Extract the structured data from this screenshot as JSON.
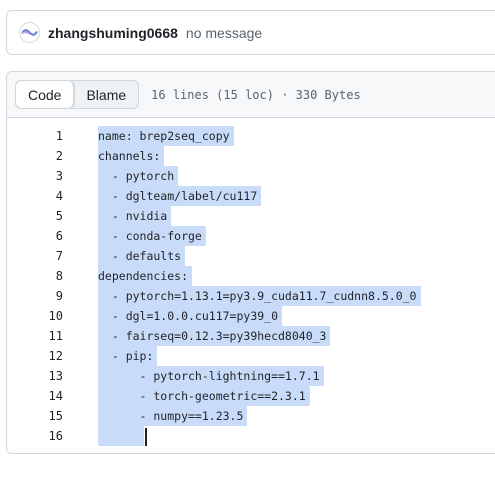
{
  "commit": {
    "author": "zhangshuming0668",
    "message": "no message",
    "avatar_icon": "avatar-wave-icon"
  },
  "file": {
    "tabs": [
      {
        "label": "Code",
        "active": true
      },
      {
        "label": "Blame",
        "active": false
      }
    ],
    "info": "16 lines (15 loc) · 330 Bytes"
  },
  "code": {
    "lines": [
      {
        "num": "1",
        "text": "name: brep2seq_copy"
      },
      {
        "num": "2",
        "text": "channels:"
      },
      {
        "num": "3",
        "text": "  - pytorch"
      },
      {
        "num": "4",
        "text": "  - dglteam/label/cu117"
      },
      {
        "num": "5",
        "text": "  - nvidia"
      },
      {
        "num": "6",
        "text": "  - conda-forge"
      },
      {
        "num": "7",
        "text": "  - defaults"
      },
      {
        "num": "8",
        "text": "dependencies:"
      },
      {
        "num": "9",
        "text": "  - pytorch=1.13.1=py3.9_cuda11.7_cudnn8.5.0_0"
      },
      {
        "num": "10",
        "text": "  - dgl=1.0.0.cu117=py39_0"
      },
      {
        "num": "11",
        "text": "  - fairseq=0.12.3=py39hecd8040_3"
      },
      {
        "num": "12",
        "text": "  - pip:"
      },
      {
        "num": "13",
        "text": "      - pytorch-lightning==1.7.1"
      },
      {
        "num": "14",
        "text": "      - torch-geometric==2.3.1"
      },
      {
        "num": "15",
        "text": "      - numpy==1.23.5"
      },
      {
        "num": "16",
        "text": "      "
      }
    ]
  },
  "colors": {
    "selection": "#c8dcf9",
    "border": "#d0d7de",
    "muted": "#59636e"
  }
}
